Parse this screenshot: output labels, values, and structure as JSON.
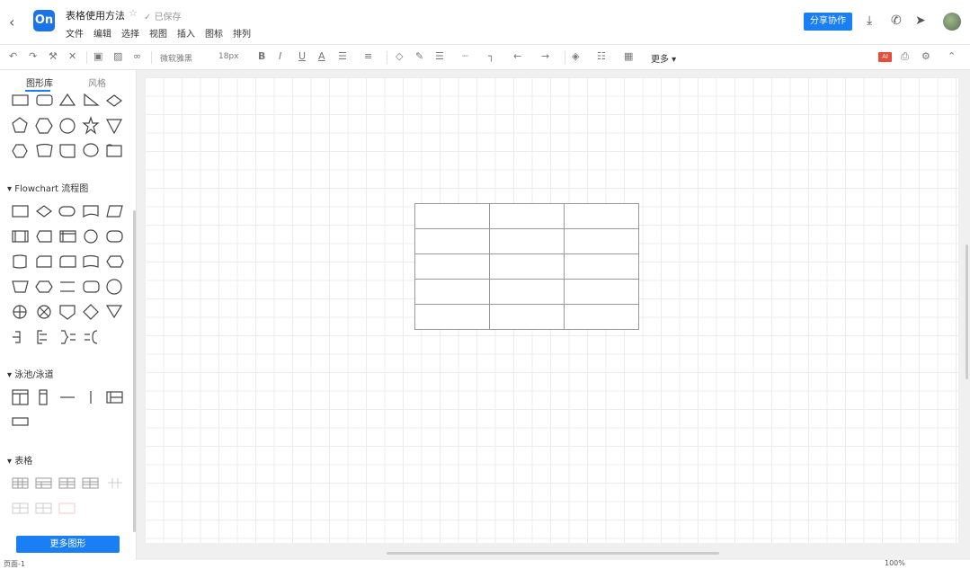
{
  "header": {
    "back_icon": "back-chevron-icon",
    "logo_text": "On",
    "title": "表格使用方法",
    "saved_status": "已保存",
    "menu": [
      "文件",
      "编辑",
      "选择",
      "视图",
      "插入",
      "图标",
      "排列"
    ],
    "share_label": "分享协作",
    "accent_color": "#1a7ef5"
  },
  "toolbar": {
    "style_label": "微软雅黑",
    "font_size": "18px",
    "more_label": "更多",
    "ai_label": "AI"
  },
  "sidebar": {
    "tabs": [
      "图形库",
      "风格"
    ],
    "sections": {
      "flowchart": "Flowchart 流程图",
      "swimlane": "泳池/泳道",
      "table": "表格"
    },
    "more_shapes_label": "更多图形"
  },
  "status": {
    "page_label": "页面-1",
    "zoom": "100%"
  }
}
